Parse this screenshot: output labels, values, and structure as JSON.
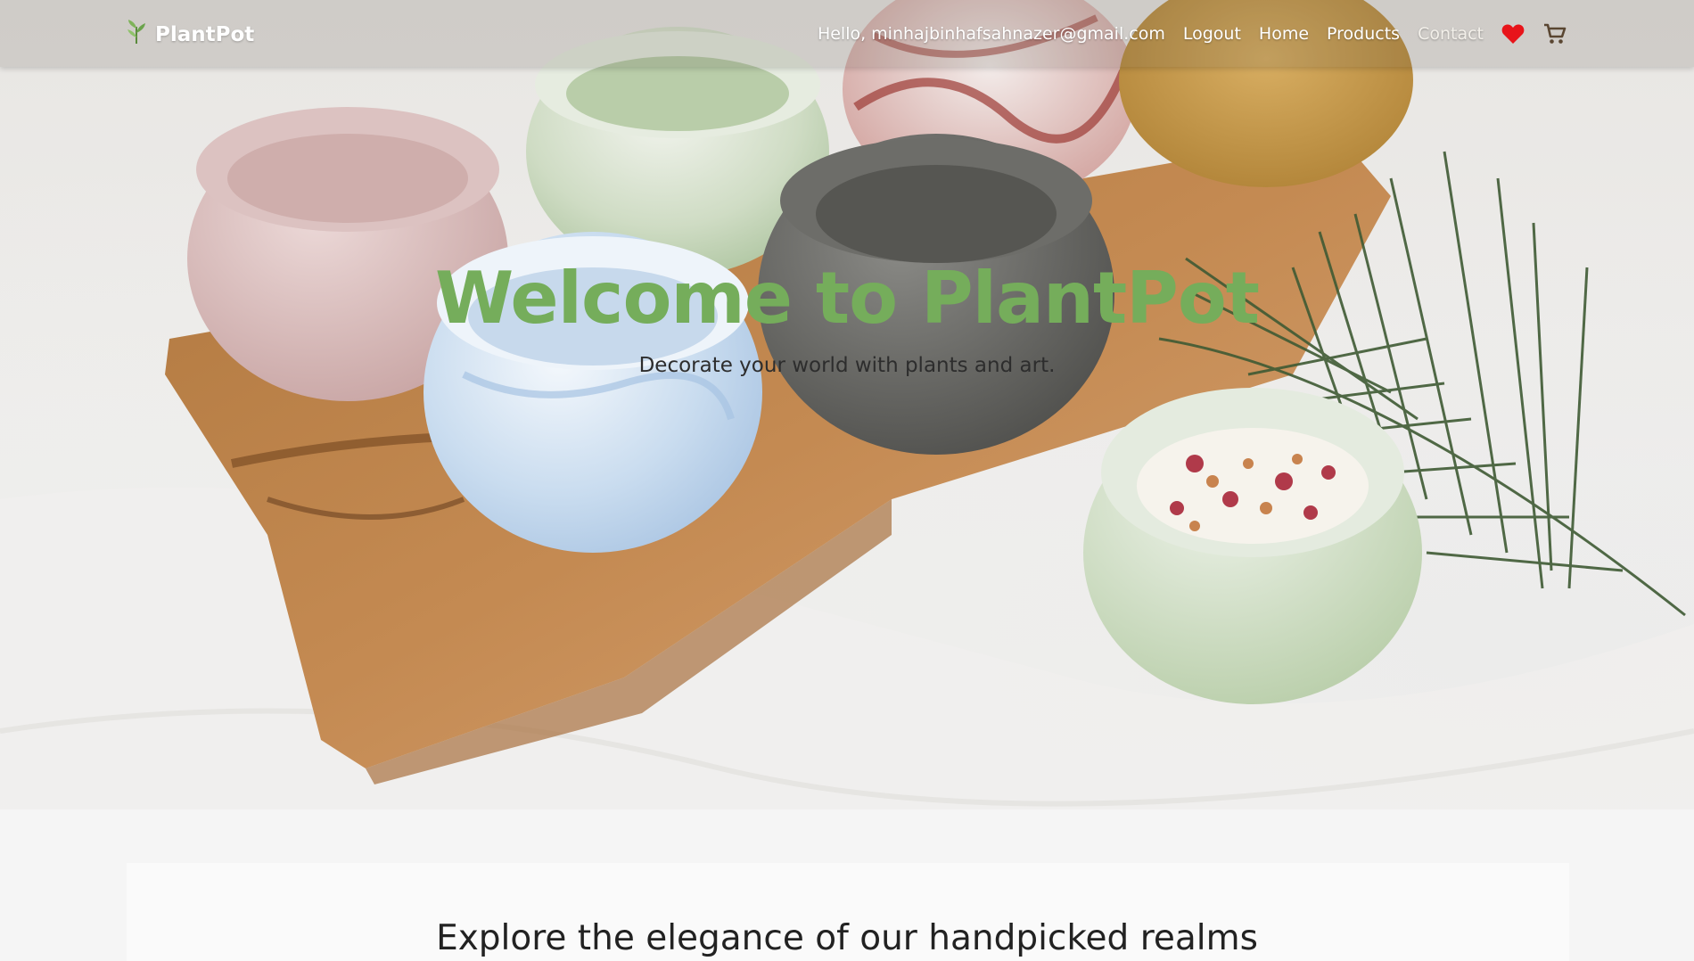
{
  "navbar": {
    "brand": "PlantPot",
    "greeting": "Hello, minhajbinhafsahnazer@gmail.com",
    "links": [
      "Logout",
      "Home",
      "Products",
      "Contact"
    ],
    "icons": [
      "heart-icon",
      "cart-icon"
    ]
  },
  "hero": {
    "title": "Welcome to PlantPot",
    "subtitle": "Decorate your world with plants and art."
  },
  "section": {
    "title": "Explore the elegance of our handpicked realms"
  },
  "colors": {
    "accent_green": "#75ad5b",
    "heart_red": "#e8141a",
    "cart_brown": "#5a4632",
    "page_bg": "#f5f5f5"
  }
}
